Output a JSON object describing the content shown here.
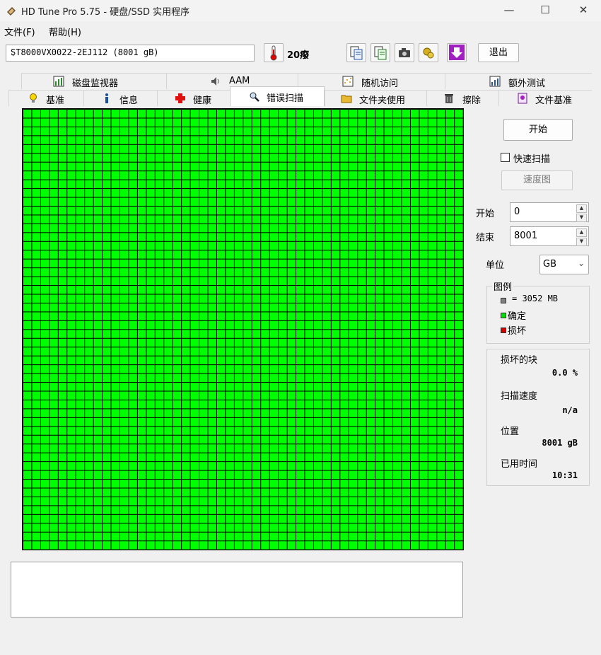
{
  "window": {
    "title": "HD Tune Pro 5.75 - 硬盘/SSD 实用程序",
    "minimize": "—",
    "maximize": "☐",
    "close": "✕"
  },
  "menu": {
    "file": "文件(F)",
    "help": "帮助(H)"
  },
  "toolbar": {
    "drive": "ST8000VX0022-2EJ112 (8001 gB)",
    "temperature": "20癈",
    "exit_label": "退出",
    "icons": [
      "copy-text-icon",
      "copy-info-icon",
      "screenshot-icon",
      "options-icon",
      "save-icon"
    ]
  },
  "tabs": {
    "row1": [
      "磁盘监视器",
      "AAM",
      "随机访问",
      "额外测试"
    ],
    "row2": [
      "基准",
      "信息",
      "健康",
      "错误扫描",
      "文件夹使用",
      "擦除",
      "文件基准"
    ],
    "active": "错误扫描"
  },
  "scan": {
    "grid_cols": 50,
    "grid_rows": 50,
    "block_color": "#00ff00",
    "bad_color": "#d40000",
    "start_button": "开始",
    "quick_scan_label": "快速扫描",
    "quick_scan_checked": false,
    "speed_map_button": "速度图",
    "start_label": "开始",
    "start_value": "0",
    "end_label": "结束",
    "end_value": "8001",
    "unit_label": "单位",
    "unit_value": "GB"
  },
  "legend": {
    "title": "图例",
    "block_size": "= 3052 MB",
    "ok": "确定",
    "damaged": "损坏"
  },
  "stats": {
    "damaged_blocks_label": "损坏的块",
    "damaged_blocks_value": "0.0 %",
    "scan_speed_label": "扫描速度",
    "scan_speed_value": "n/a",
    "position_label": "位置",
    "position_value": "8001 gB",
    "elapsed_label": "已用时间",
    "elapsed_value": "10:31"
  }
}
